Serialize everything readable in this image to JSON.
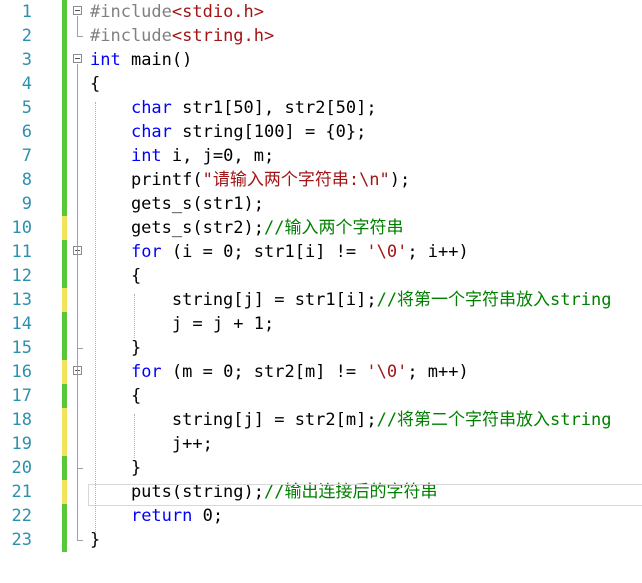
{
  "editor": {
    "language": "C",
    "lines": [
      {
        "num": "1",
        "tokens": [
          {
            "t": "#include",
            "c": "pp"
          },
          {
            "t": "<stdio.h>",
            "c": "inc"
          }
        ],
        "change": "green"
      },
      {
        "num": "2",
        "tokens": [
          {
            "t": "#include",
            "c": "pp"
          },
          {
            "t": "<string.h>",
            "c": "inc"
          }
        ],
        "change": "green"
      },
      {
        "num": "3",
        "tokens": [
          {
            "t": "int",
            "c": "kw"
          },
          {
            "t": " main()",
            "c": ""
          }
        ],
        "change": "green"
      },
      {
        "num": "4",
        "tokens": [
          {
            "t": "{",
            "c": ""
          }
        ],
        "change": "green"
      },
      {
        "num": "5",
        "tokens": [
          {
            "t": "    ",
            "c": ""
          },
          {
            "t": "char",
            "c": "kw"
          },
          {
            "t": " str1[50], str2[50];",
            "c": ""
          }
        ],
        "change": "green"
      },
      {
        "num": "6",
        "tokens": [
          {
            "t": "    ",
            "c": ""
          },
          {
            "t": "char",
            "c": "kw"
          },
          {
            "t": " string[100] = {0};",
            "c": ""
          }
        ],
        "change": "green"
      },
      {
        "num": "7",
        "tokens": [
          {
            "t": "    ",
            "c": ""
          },
          {
            "t": "int",
            "c": "kw"
          },
          {
            "t": " i, j=0, m;",
            "c": ""
          }
        ],
        "change": "green"
      },
      {
        "num": "8",
        "tokens": [
          {
            "t": "    printf(",
            "c": ""
          },
          {
            "t": "\"请输入两个字符串:\\n\"",
            "c": "str"
          },
          {
            "t": ");",
            "c": ""
          }
        ],
        "change": "green"
      },
      {
        "num": "9",
        "tokens": [
          {
            "t": "    gets_s(str1);",
            "c": ""
          }
        ],
        "change": "green"
      },
      {
        "num": "10",
        "tokens": [
          {
            "t": "    gets_s(str2);",
            "c": ""
          },
          {
            "t": "//输入两个字符串",
            "c": "cmt"
          }
        ],
        "change": "yellow"
      },
      {
        "num": "11",
        "tokens": [
          {
            "t": "    ",
            "c": ""
          },
          {
            "t": "for",
            "c": "kw"
          },
          {
            "t": " (i = 0; str1[i] != ",
            "c": ""
          },
          {
            "t": "'\\0'",
            "c": "str"
          },
          {
            "t": "; i++)",
            "c": ""
          }
        ],
        "change": "green"
      },
      {
        "num": "12",
        "tokens": [
          {
            "t": "    {",
            "c": ""
          }
        ],
        "change": "green"
      },
      {
        "num": "13",
        "tokens": [
          {
            "t": "        string[j] = str1[i];",
            "c": ""
          },
          {
            "t": "//将第一个字符串放入string",
            "c": "cmt"
          }
        ],
        "change": "yellow"
      },
      {
        "num": "14",
        "tokens": [
          {
            "t": "        j = j + 1;",
            "c": ""
          }
        ],
        "change": "green"
      },
      {
        "num": "15",
        "tokens": [
          {
            "t": "    }",
            "c": ""
          }
        ],
        "change": "green"
      },
      {
        "num": "16",
        "tokens": [
          {
            "t": "    ",
            "c": ""
          },
          {
            "t": "for",
            "c": "kw"
          },
          {
            "t": " (m = 0; str2[m] != ",
            "c": ""
          },
          {
            "t": "'\\0'",
            "c": "str"
          },
          {
            "t": "; m++)",
            "c": ""
          }
        ],
        "change": "yellow"
      },
      {
        "num": "17",
        "tokens": [
          {
            "t": "    {",
            "c": ""
          }
        ],
        "change": "green"
      },
      {
        "num": "18",
        "tokens": [
          {
            "t": "        string[j] = str2[m];",
            "c": ""
          },
          {
            "t": "//将第二个字符串放入string",
            "c": "cmt"
          }
        ],
        "change": "yellow"
      },
      {
        "num": "19",
        "tokens": [
          {
            "t": "        j++;",
            "c": ""
          }
        ],
        "change": "yellow"
      },
      {
        "num": "20",
        "tokens": [
          {
            "t": "    }",
            "c": ""
          }
        ],
        "change": "green"
      },
      {
        "num": "21",
        "tokens": [
          {
            "t": "    puts(string);",
            "c": ""
          },
          {
            "t": "//输出连接后的字符串",
            "c": "cmt"
          }
        ],
        "change": "yellow"
      },
      {
        "num": "22",
        "tokens": [
          {
            "t": "    ",
            "c": ""
          },
          {
            "t": "return",
            "c": "kw"
          },
          {
            "t": " 0;",
            "c": ""
          }
        ],
        "change": "green"
      },
      {
        "num": "23",
        "tokens": [
          {
            "t": "}",
            "c": ""
          }
        ],
        "change": "green"
      }
    ],
    "colors": {
      "keyword": "#0000ff",
      "preprocessor": "#808080",
      "string": "#a31515",
      "comment": "#008000",
      "line_number": "#2b91af",
      "change_saved": "#57c83a",
      "change_unsaved": "#f1e35a"
    },
    "fold_markers": [
      "1",
      "3",
      "11",
      "16"
    ],
    "current_line": "21"
  }
}
